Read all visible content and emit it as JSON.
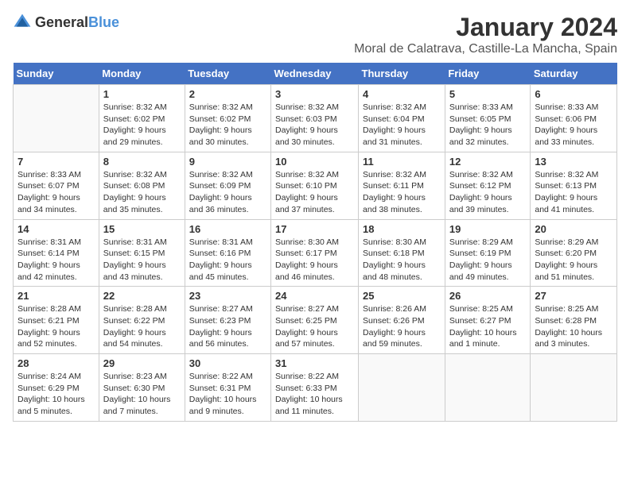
{
  "header": {
    "logo_general": "General",
    "logo_blue": "Blue",
    "title": "January 2024",
    "subtitle": "Moral de Calatrava, Castille-La Mancha, Spain"
  },
  "days_of_week": [
    "Sunday",
    "Monday",
    "Tuesday",
    "Wednesday",
    "Thursday",
    "Friday",
    "Saturday"
  ],
  "weeks": [
    [
      {
        "day": "",
        "info": ""
      },
      {
        "day": "1",
        "info": "Sunrise: 8:32 AM\nSunset: 6:02 PM\nDaylight: 9 hours\nand 29 minutes."
      },
      {
        "day": "2",
        "info": "Sunrise: 8:32 AM\nSunset: 6:02 PM\nDaylight: 9 hours\nand 30 minutes."
      },
      {
        "day": "3",
        "info": "Sunrise: 8:32 AM\nSunset: 6:03 PM\nDaylight: 9 hours\nand 30 minutes."
      },
      {
        "day": "4",
        "info": "Sunrise: 8:32 AM\nSunset: 6:04 PM\nDaylight: 9 hours\nand 31 minutes."
      },
      {
        "day": "5",
        "info": "Sunrise: 8:33 AM\nSunset: 6:05 PM\nDaylight: 9 hours\nand 32 minutes."
      },
      {
        "day": "6",
        "info": "Sunrise: 8:33 AM\nSunset: 6:06 PM\nDaylight: 9 hours\nand 33 minutes."
      }
    ],
    [
      {
        "day": "7",
        "info": ""
      },
      {
        "day": "8",
        "info": "Sunrise: 8:32 AM\nSunset: 6:08 PM\nDaylight: 9 hours\nand 35 minutes."
      },
      {
        "day": "9",
        "info": "Sunrise: 8:32 AM\nSunset: 6:09 PM\nDaylight: 9 hours\nand 36 minutes."
      },
      {
        "day": "10",
        "info": "Sunrise: 8:32 AM\nSunset: 6:10 PM\nDaylight: 9 hours\nand 37 minutes."
      },
      {
        "day": "11",
        "info": "Sunrise: 8:32 AM\nSunset: 6:11 PM\nDaylight: 9 hours\nand 38 minutes."
      },
      {
        "day": "12",
        "info": "Sunrise: 8:32 AM\nSunset: 6:12 PM\nDaylight: 9 hours\nand 39 minutes."
      },
      {
        "day": "13",
        "info": "Sunrise: 8:32 AM\nSunset: 6:13 PM\nDaylight: 9 hours\nand 41 minutes."
      }
    ],
    [
      {
        "day": "14",
        "info": ""
      },
      {
        "day": "15",
        "info": "Sunrise: 8:31 AM\nSunset: 6:15 PM\nDaylight: 9 hours\nand 43 minutes."
      },
      {
        "day": "16",
        "info": "Sunrise: 8:31 AM\nSunset: 6:16 PM\nDaylight: 9 hours\nand 45 minutes."
      },
      {
        "day": "17",
        "info": "Sunrise: 8:30 AM\nSunset: 6:17 PM\nDaylight: 9 hours\nand 46 minutes."
      },
      {
        "day": "18",
        "info": "Sunrise: 8:30 AM\nSunset: 6:18 PM\nDaylight: 9 hours\nand 48 minutes."
      },
      {
        "day": "19",
        "info": "Sunrise: 8:29 AM\nSunset: 6:19 PM\nDaylight: 9 hours\nand 49 minutes."
      },
      {
        "day": "20",
        "info": "Sunrise: 8:29 AM\nSunset: 6:20 PM\nDaylight: 9 hours\nand 51 minutes."
      }
    ],
    [
      {
        "day": "21",
        "info": ""
      },
      {
        "day": "22",
        "info": "Sunrise: 8:28 AM\nSunset: 6:22 PM\nDaylight: 9 hours\nand 54 minutes."
      },
      {
        "day": "23",
        "info": "Sunrise: 8:27 AM\nSunset: 6:23 PM\nDaylight: 9 hours\nand 56 minutes."
      },
      {
        "day": "24",
        "info": "Sunrise: 8:27 AM\nSunset: 6:25 PM\nDaylight: 9 hours\nand 57 minutes."
      },
      {
        "day": "25",
        "info": "Sunrise: 8:26 AM\nSunset: 6:26 PM\nDaylight: 9 hours\nand 59 minutes."
      },
      {
        "day": "26",
        "info": "Sunrise: 8:25 AM\nSunset: 6:27 PM\nDaylight: 10 hours\nand 1 minute."
      },
      {
        "day": "27",
        "info": "Sunrise: 8:25 AM\nSunset: 6:28 PM\nDaylight: 10 hours\nand 3 minutes."
      }
    ],
    [
      {
        "day": "28",
        "info": ""
      },
      {
        "day": "29",
        "info": "Sunrise: 8:23 AM\nSunset: 6:30 PM\nDaylight: 10 hours\nand 7 minutes."
      },
      {
        "day": "30",
        "info": "Sunrise: 8:22 AM\nSunset: 6:31 PM\nDaylight: 10 hours\nand 9 minutes."
      },
      {
        "day": "31",
        "info": "Sunrise: 8:22 AM\nSunset: 6:33 PM\nDaylight: 10 hours\nand 11 minutes."
      },
      {
        "day": "",
        "info": ""
      },
      {
        "day": "",
        "info": ""
      },
      {
        "day": "",
        "info": ""
      }
    ]
  ],
  "week0_sunday_info": "Sunrise: 8:33 AM\nSunset: 6:07 PM\nDaylight: 9 hours\nand 34 minutes.",
  "week2_sunday_info": "Sunrise: 8:31 AM\nSunset: 6:14 PM\nDaylight: 9 hours\nand 42 minutes.",
  "week3_sunday_info": "Sunrise: 8:28 AM\nSunset: 6:21 PM\nDaylight: 9 hours\nand 52 minutes.",
  "week4_sunday_info": "Sunrise: 8:24 AM\nSunset: 6:29 PM\nDaylight: 10 hours\nand 5 minutes."
}
